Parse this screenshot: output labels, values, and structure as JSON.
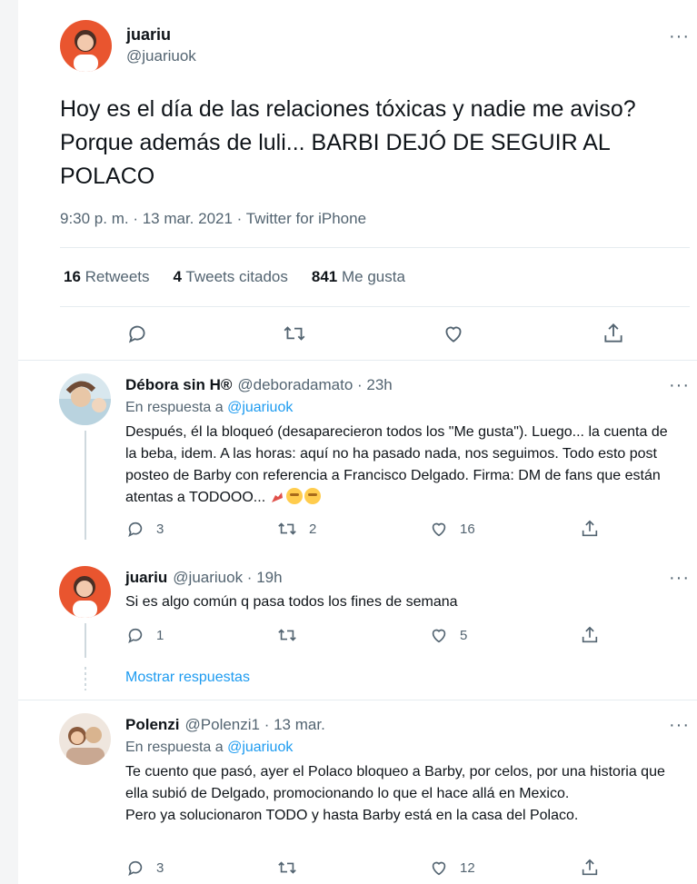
{
  "main_tweet": {
    "display_name": "juariu",
    "handle": "@juariuok",
    "text": "Hoy es el día de las relaciones tóxicas y nadie me aviso? Porque además de luli... BARBI DEJÓ DE SEGUIR AL POLACO",
    "meta": "9:30 p. m. · 13 mar. 2021 · Twitter for iPhone",
    "stats": {
      "retweets_count": "16",
      "retweets_label": "Retweets",
      "quotes_count": "4",
      "quotes_label": "Tweets citados",
      "likes_count": "841",
      "likes_label": "Me gusta"
    },
    "more_icon": "more-dots-icon"
  },
  "replies": [
    {
      "display_name": "Débora sin H®",
      "meta": "@deboradamato · 23h",
      "reply_to_label": "En respuesta a",
      "reply_to_handle": "@juariuok",
      "text": "Después, él la bloqueó (desaparecieron todos los \"Me gusta\"). Luego... la cuenta de la beba, idem. A las horas: aquí no ha pasado nada, nos seguimos. Todo esto post posteo de Barby con referencia a Francisco Delgado. Firma: DM de fans que están atentas a TODOOO...",
      "reply_count": "3",
      "retweet_count": "2",
      "like_count": "16"
    },
    {
      "display_name": "juariu",
      "meta": "@juariuok · 19h",
      "text": "Si es algo común q pasa todos los fines de semana",
      "reply_count": "1",
      "retweet_count": "",
      "like_count": "5"
    },
    {
      "display_name": "Polenzi",
      "meta": "@Polenzi1 · 13 mar.",
      "reply_to_label": "En respuesta a",
      "reply_to_handle": "@juariuok",
      "text_lines": [
        "Te cuento que pasó, ayer el Polaco bloqueo a Barby, por celos, por una historia que ella subió de Delgado, promocionando lo que el hace allá en Mexico.",
        "Pero ya solucionaron TODO y hasta Barby está en la casa del Polaco."
      ],
      "reply_count": "3",
      "retweet_count": "",
      "like_count": "12"
    }
  ],
  "show_replies_label": "Mostrar respuestas",
  "colors": {
    "link": "#1d9bf0",
    "secondary_text": "#536471",
    "divider": "#e6ecf0"
  }
}
